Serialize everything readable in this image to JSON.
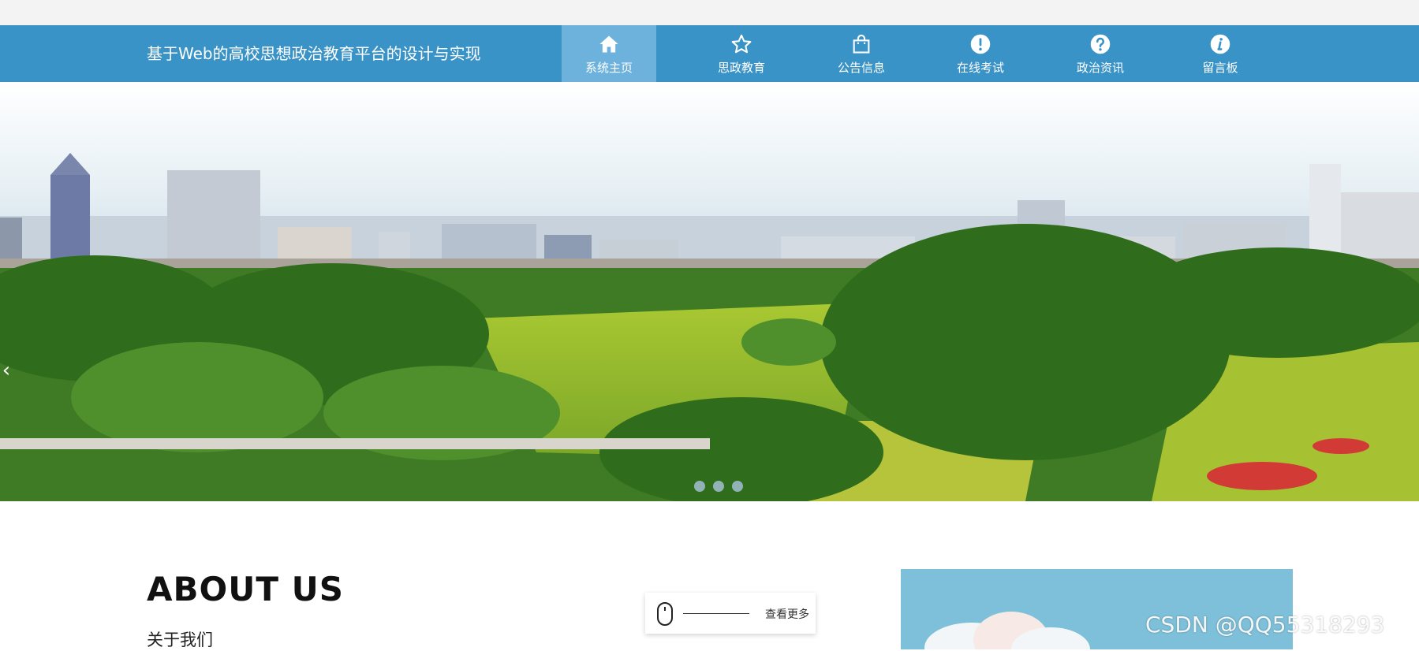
{
  "header": {
    "site_title": "基于Web的高校思想政治教育平台的设计与实现"
  },
  "nav": {
    "items": [
      {
        "label": "系统主页",
        "icon": "home-icon"
      },
      {
        "label": "思政教育",
        "icon": "star-icon"
      },
      {
        "label": "公告信息",
        "icon": "shopping-bag-icon"
      },
      {
        "label": "在线考试",
        "icon": "exclamation-circle-icon"
      },
      {
        "label": "政治资讯",
        "icon": "question-circle-icon"
      },
      {
        "label": "留言板",
        "icon": "info-circle-icon"
      }
    ],
    "active_index": 0
  },
  "banner": {
    "description_icon": "city-park-panorama",
    "dots": 3
  },
  "about": {
    "title": "ABOUT US",
    "subtitle": "关于我们",
    "more_label": "查看更多"
  },
  "watermark": "CSDN @QQ55318293",
  "colors": {
    "nav_bg": "#3a93c6",
    "nav_active": "#6cb2dc"
  }
}
